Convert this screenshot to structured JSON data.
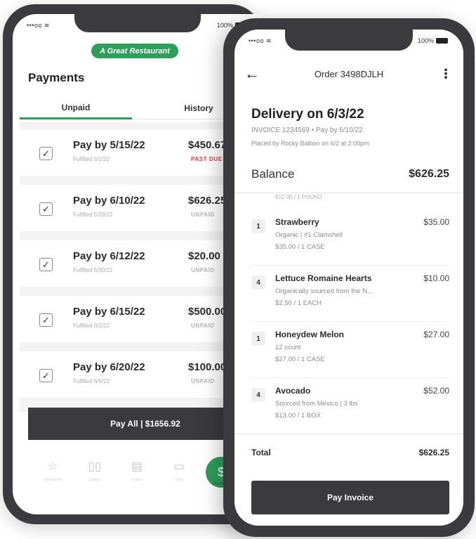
{
  "payments_screen": {
    "status": {
      "signal": "•••oo",
      "battery": "100%"
    },
    "brand": "A Great Restaurant",
    "title": "Payments",
    "tabs": [
      {
        "label": "Unpaid",
        "active": true
      },
      {
        "label": "History",
        "active": false
      }
    ],
    "rows": [
      {
        "title": "Pay by 5/15/22",
        "sub": "Fulfilled 5/1/22",
        "amount": "$450.67",
        "status": "PAST DUE",
        "checked": true
      },
      {
        "title": "Pay by 6/10/22",
        "sub": "Fulfilled 5/28/22",
        "amount": "$626.25",
        "status": "UNPAID",
        "checked": true
      },
      {
        "title": "Pay by 6/12/22",
        "sub": "Fulfilled 5/30/22",
        "amount": "$20.00",
        "status": "UNPAID",
        "checked": true
      },
      {
        "title": "Pay by 6/15/22",
        "sub": "Fulfilled 6/1/22",
        "amount": "$500.00",
        "status": "UNPAID",
        "checked": true
      },
      {
        "title": "Pay by 6/20/22",
        "sub": "Fulfilled 6/6/22",
        "amount": "$100.00",
        "status": "UNPAID",
        "checked": true
      }
    ],
    "pay_all": "Pay All | $1656.92",
    "nav": [
      {
        "icon": "star-icon",
        "label": "Get Started"
      },
      {
        "icon": "book-icon",
        "label": "Catalog"
      },
      {
        "icon": "list-icon",
        "label": "Orders"
      },
      {
        "icon": "chat-icon",
        "label": "Chat"
      },
      {
        "icon": "dollar-icon",
        "label": "Payments",
        "active": true
      }
    ]
  },
  "order_screen": {
    "status": {
      "signal": "•••oo",
      "battery": "100%"
    },
    "order_title": "Order 3498DJLH",
    "delivery": "Delivery on 6/3/22",
    "invoice_line": "INVOICE 1234569 • Pay by 6/10/22",
    "placed_line": "Placed by Rocky Balboo on 6/2 at 2:00pm",
    "balance_label": "Balance",
    "balance_amount": "$626.25",
    "cut_text": "$12.00 / 1 POUND",
    "items": [
      {
        "qty": "1",
        "name": "Strawberry",
        "desc": "Organic | #1 Clamshell",
        "unit": "$35.00 / 1 CASE",
        "amount": "$35.00"
      },
      {
        "qty": "4",
        "name": "Lettuce Romaine Hearts",
        "desc": "Organically sourced from the N...",
        "unit": "$2.50 / 1 EACH",
        "amount": "$10.00"
      },
      {
        "qty": "1",
        "name": "Honeydew Melon",
        "desc": "12 count",
        "unit": "$27.00 / 1 CASE",
        "amount": "$27.00"
      },
      {
        "qty": "4",
        "name": "Avocado",
        "desc": "Sourced from Mexico | 3 lbs",
        "unit": "$13.00 / 1 BOX",
        "amount": "$52.00"
      }
    ],
    "total_label": "Total",
    "total_amount": "$626.25",
    "pay_invoice": "Pay Invoice"
  }
}
